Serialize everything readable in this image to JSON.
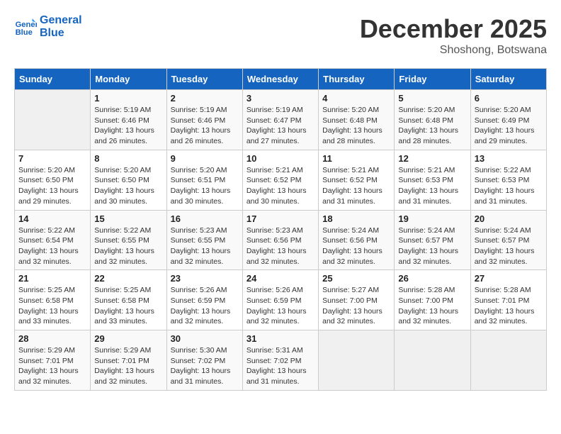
{
  "header": {
    "logo_line1": "General",
    "logo_line2": "Blue",
    "month": "December 2025",
    "location": "Shoshong, Botswana"
  },
  "days_of_week": [
    "Sunday",
    "Monday",
    "Tuesday",
    "Wednesday",
    "Thursday",
    "Friday",
    "Saturday"
  ],
  "weeks": [
    [
      {
        "day": "",
        "info": ""
      },
      {
        "day": "1",
        "info": "Sunrise: 5:19 AM\nSunset: 6:46 PM\nDaylight: 13 hours\nand 26 minutes."
      },
      {
        "day": "2",
        "info": "Sunrise: 5:19 AM\nSunset: 6:46 PM\nDaylight: 13 hours\nand 26 minutes."
      },
      {
        "day": "3",
        "info": "Sunrise: 5:19 AM\nSunset: 6:47 PM\nDaylight: 13 hours\nand 27 minutes."
      },
      {
        "day": "4",
        "info": "Sunrise: 5:20 AM\nSunset: 6:48 PM\nDaylight: 13 hours\nand 28 minutes."
      },
      {
        "day": "5",
        "info": "Sunrise: 5:20 AM\nSunset: 6:48 PM\nDaylight: 13 hours\nand 28 minutes."
      },
      {
        "day": "6",
        "info": "Sunrise: 5:20 AM\nSunset: 6:49 PM\nDaylight: 13 hours\nand 29 minutes."
      }
    ],
    [
      {
        "day": "7",
        "info": "Sunrise: 5:20 AM\nSunset: 6:50 PM\nDaylight: 13 hours\nand 29 minutes."
      },
      {
        "day": "8",
        "info": "Sunrise: 5:20 AM\nSunset: 6:50 PM\nDaylight: 13 hours\nand 30 minutes."
      },
      {
        "day": "9",
        "info": "Sunrise: 5:20 AM\nSunset: 6:51 PM\nDaylight: 13 hours\nand 30 minutes."
      },
      {
        "day": "10",
        "info": "Sunrise: 5:21 AM\nSunset: 6:52 PM\nDaylight: 13 hours\nand 30 minutes."
      },
      {
        "day": "11",
        "info": "Sunrise: 5:21 AM\nSunset: 6:52 PM\nDaylight: 13 hours\nand 31 minutes."
      },
      {
        "day": "12",
        "info": "Sunrise: 5:21 AM\nSunset: 6:53 PM\nDaylight: 13 hours\nand 31 minutes."
      },
      {
        "day": "13",
        "info": "Sunrise: 5:22 AM\nSunset: 6:53 PM\nDaylight: 13 hours\nand 31 minutes."
      }
    ],
    [
      {
        "day": "14",
        "info": "Sunrise: 5:22 AM\nSunset: 6:54 PM\nDaylight: 13 hours\nand 32 minutes."
      },
      {
        "day": "15",
        "info": "Sunrise: 5:22 AM\nSunset: 6:55 PM\nDaylight: 13 hours\nand 32 minutes."
      },
      {
        "day": "16",
        "info": "Sunrise: 5:23 AM\nSunset: 6:55 PM\nDaylight: 13 hours\nand 32 minutes."
      },
      {
        "day": "17",
        "info": "Sunrise: 5:23 AM\nSunset: 6:56 PM\nDaylight: 13 hours\nand 32 minutes."
      },
      {
        "day": "18",
        "info": "Sunrise: 5:24 AM\nSunset: 6:56 PM\nDaylight: 13 hours\nand 32 minutes."
      },
      {
        "day": "19",
        "info": "Sunrise: 5:24 AM\nSunset: 6:57 PM\nDaylight: 13 hours\nand 32 minutes."
      },
      {
        "day": "20",
        "info": "Sunrise: 5:24 AM\nSunset: 6:57 PM\nDaylight: 13 hours\nand 32 minutes."
      }
    ],
    [
      {
        "day": "21",
        "info": "Sunrise: 5:25 AM\nSunset: 6:58 PM\nDaylight: 13 hours\nand 33 minutes."
      },
      {
        "day": "22",
        "info": "Sunrise: 5:25 AM\nSunset: 6:58 PM\nDaylight: 13 hours\nand 33 minutes."
      },
      {
        "day": "23",
        "info": "Sunrise: 5:26 AM\nSunset: 6:59 PM\nDaylight: 13 hours\nand 32 minutes."
      },
      {
        "day": "24",
        "info": "Sunrise: 5:26 AM\nSunset: 6:59 PM\nDaylight: 13 hours\nand 32 minutes."
      },
      {
        "day": "25",
        "info": "Sunrise: 5:27 AM\nSunset: 7:00 PM\nDaylight: 13 hours\nand 32 minutes."
      },
      {
        "day": "26",
        "info": "Sunrise: 5:28 AM\nSunset: 7:00 PM\nDaylight: 13 hours\nand 32 minutes."
      },
      {
        "day": "27",
        "info": "Sunrise: 5:28 AM\nSunset: 7:01 PM\nDaylight: 13 hours\nand 32 minutes."
      }
    ],
    [
      {
        "day": "28",
        "info": "Sunrise: 5:29 AM\nSunset: 7:01 PM\nDaylight: 13 hours\nand 32 minutes."
      },
      {
        "day": "29",
        "info": "Sunrise: 5:29 AM\nSunset: 7:01 PM\nDaylight: 13 hours\nand 32 minutes."
      },
      {
        "day": "30",
        "info": "Sunrise: 5:30 AM\nSunset: 7:02 PM\nDaylight: 13 hours\nand 31 minutes."
      },
      {
        "day": "31",
        "info": "Sunrise: 5:31 AM\nSunset: 7:02 PM\nDaylight: 13 hours\nand 31 minutes."
      },
      {
        "day": "",
        "info": ""
      },
      {
        "day": "",
        "info": ""
      },
      {
        "day": "",
        "info": ""
      }
    ]
  ]
}
